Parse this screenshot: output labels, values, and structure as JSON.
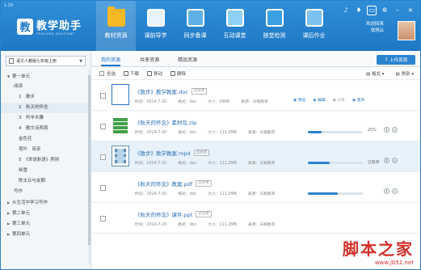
{
  "app": {
    "version": "1.20",
    "logo_char": "教",
    "title": "教学助手",
    "subtitle": "TEACHING ASSISTANT"
  },
  "nav": [
    {
      "label": "教材资源",
      "icon": "folder-icon"
    },
    {
      "label": "课前导学",
      "icon": "book-icon"
    },
    {
      "label": "同步备课",
      "icon": "whiteboard-icon"
    },
    {
      "label": "互动课堂",
      "icon": "monitor-icon"
    },
    {
      "label": "随堂检测",
      "icon": "checklist-icon"
    },
    {
      "label": "课后作业",
      "icon": "clipboard-icon"
    }
  ],
  "window_controls": [
    "bell-icon",
    "shirt-icon",
    "message-icon",
    "gear-icon",
    "minimize-icon",
    "close-icon"
  ],
  "user": {
    "line1": "欢迎回来",
    "line2": "张旭云"
  },
  "sidebar": {
    "book": "语文人教版七年级上册",
    "tree": [
      {
        "label": "第一单元",
        "kind": "unit-open"
      },
      {
        "label": "阅读",
        "kind": "lvl1n"
      },
      {
        "label": "1　散步",
        "kind": "lvl1"
      },
      {
        "label": "2　秋天的怀念",
        "kind": "lvl1"
      },
      {
        "label": "3　羚羊木雕",
        "kind": "lvl1"
      },
      {
        "label": "4　散文诗两首",
        "kind": "lvl1"
      },
      {
        "label": "金色花",
        "kind": "lvl1"
      },
      {
        "label": "荷叶　母亲",
        "kind": "lvl1"
      },
      {
        "label": "5　《世说新语》两则",
        "kind": "lvl1"
      },
      {
        "label": "咏雪",
        "kind": "lvl1"
      },
      {
        "label": "陈太丘与友期",
        "kind": "lvl1"
      },
      {
        "label": "写作",
        "kind": "lvl1n"
      },
      {
        "label": "从生活中学习写作",
        "kind": "unit"
      },
      {
        "label": "第二单元",
        "kind": "unit"
      },
      {
        "label": "第三单元",
        "kind": "unit"
      },
      {
        "label": "第四单元",
        "kind": "unit"
      }
    ]
  },
  "tabs": [
    "我的资源",
    "共享资源",
    "精品资源"
  ],
  "upload_label": "上传资源",
  "toolbar": {
    "select_all": "全选",
    "download": "下载",
    "move": "移动",
    "delete": "删除",
    "format": "格式",
    "category": "类别"
  },
  "files": [
    {
      "name": "《散步》教学教案.doc",
      "badge": "已分享",
      "time": "时间：2014-7-20",
      "format": "格式：doc",
      "size": "大小：69KB",
      "source": "来源：天喻教育",
      "icon": "word-icon",
      "state": "actions",
      "actions": [
        "预览",
        "编辑",
        "分享",
        "更多"
      ]
    },
    {
      "name": "《秋天的怀念》素材包.zip",
      "badge": "",
      "time": "时间：2014-7-20",
      "format": "格式：doc",
      "size": "大小：111.2MB",
      "source": "来源：天喻教育",
      "icon": "zip-icon",
      "state": "progress",
      "progress": 0.25,
      "pct": "25%"
    },
    {
      "name": "《散步》教学教案.mp4",
      "badge": "已分享",
      "time": "时间：2014-7-20",
      "format": "格式：doc",
      "size": "大小：111.2MB",
      "source": "来源：天喻教育",
      "icon": "video-icon",
      "state": "progress",
      "progress": 0.4,
      "pct": "已暂停"
    },
    {
      "name": "《秋天的怀念》教案.pdf",
      "badge": "已分享",
      "time": "时间：2014-7-20",
      "format": "格式：doc",
      "size": "大小：111.2MB",
      "source": "来源：天喻教育",
      "icon": "pdf-icon",
      "state": "progress",
      "progress": 0.55,
      "pct": ""
    },
    {
      "name": "《秋天的怀念》课件.ppt",
      "badge": "已分享",
      "time": "时间：2014-7-20",
      "format": "格式：doc",
      "size": "大小：111.2MB",
      "source": "来源：天喻教育",
      "icon": "ppt-icon",
      "state": "none"
    }
  ],
  "watermark": {
    "title": "脚本之家",
    "url": "www.jb51.net"
  }
}
